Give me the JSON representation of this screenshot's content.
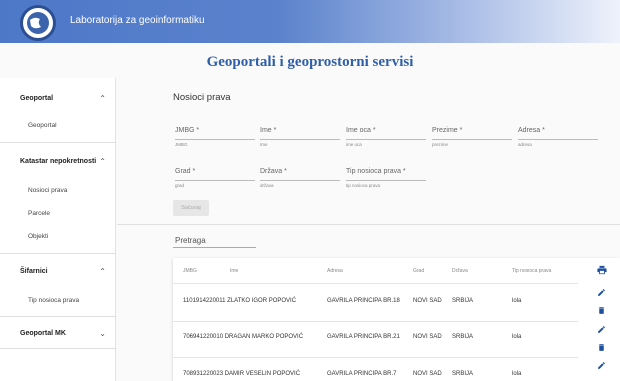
{
  "header": {
    "app_title": "Laboratorija za geoinformatiku"
  },
  "page_title": "Geoportali i geoprostorni servisi",
  "sidebar": {
    "sections": [
      {
        "label": "Geoportal",
        "items": [
          "Geoportal"
        ]
      },
      {
        "label": "Katastar nepokretnosti",
        "items": [
          "Nosioci prava",
          "Parcele",
          "Objekti"
        ]
      },
      {
        "label": "Šifarnici",
        "items": [
          "Tip nosioca prava"
        ]
      },
      {
        "label": "Geoportal MK",
        "items": []
      }
    ]
  },
  "form": {
    "title": "Nosioci prava",
    "fields": [
      {
        "label": "JMBG *",
        "hint": "JMBG"
      },
      {
        "label": "Ime *",
        "hint": "Ime"
      },
      {
        "label": "Ime oca *",
        "hint": "ime oca"
      },
      {
        "label": "Prezime *",
        "hint": "prezime"
      },
      {
        "label": "Adresa *",
        "hint": "adresa"
      },
      {
        "label": "Grad *",
        "hint": "grad"
      },
      {
        "label": "Država *",
        "hint": "država"
      },
      {
        "label": "Tip nosioca prava *",
        "hint": "tip nosioca prava"
      }
    ],
    "save_label": "Sačuvaj"
  },
  "search": {
    "label": "Pretraga"
  },
  "table": {
    "headers": [
      "JMBG",
      "Ime",
      "Adresa",
      "Grad",
      "Država",
      "Tip nosioca prava"
    ],
    "rows": [
      {
        "jmbg_name": "1101914220011 ZLATKO IGOR POPOVIĆ",
        "adresa": "GAVRILA PRINCIPA BR.18",
        "grad": "NOVI SAD",
        "drzava": "SRBIJA",
        "tip": "lola"
      },
      {
        "jmbg_name": "706941220010 DRAGAN MARKO POPOVIĆ",
        "adresa": "GAVRILA PRINCIPA BR.21",
        "grad": "NOVI SAD",
        "drzava": "SRBIJA",
        "tip": "lola"
      },
      {
        "jmbg_name": "708931220023 DAMIR VESELIN POPOVIĆ",
        "adresa": "GAVRILA PRINCIPA BR.7",
        "grad": "NOVI SAD",
        "drzava": "SRBIJA",
        "tip": "lola"
      }
    ]
  },
  "colors": {
    "accent": "#2f5fa8",
    "header": "#4d78c8",
    "action": "#1e4fa0"
  },
  "icons": {
    "print": "print-icon",
    "edit": "pencil-icon",
    "delete": "trash-icon",
    "expand": "chevron-icon"
  }
}
